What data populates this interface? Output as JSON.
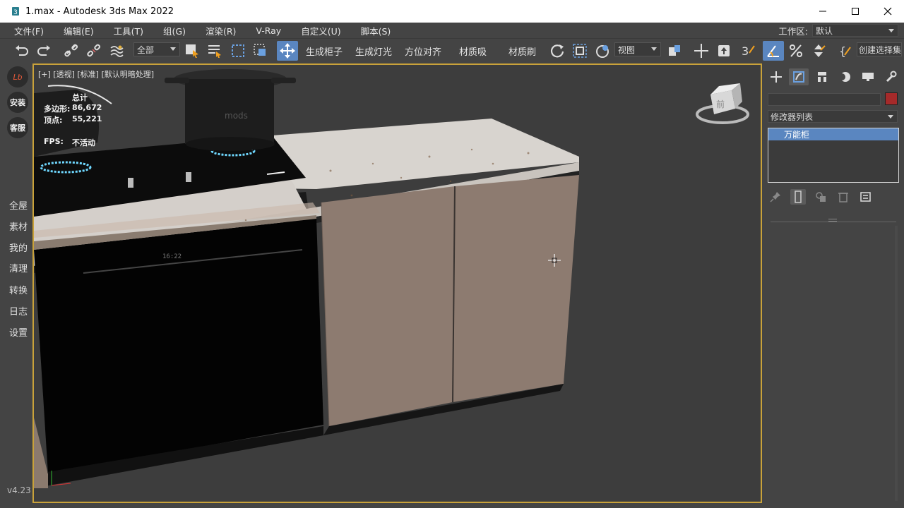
{
  "window": {
    "title": "1.max - Autodesk 3ds Max 2022"
  },
  "menu": [
    "文件(F)",
    "编辑(E)",
    "工具(T)",
    "组(G)",
    "渲染(R)",
    "V-Ray",
    "自定义(U)",
    "脚本(S)"
  ],
  "workspace": {
    "label": "工作区:",
    "value": "默认"
  },
  "toolbar": {
    "selection_filter": "全部",
    "buttons": [
      "生成柜子",
      "生成灯光",
      "方位对齐",
      "材质吸",
      "材质刷"
    ],
    "ref_coord": "视图",
    "named_selection": "创建选择集"
  },
  "sidebar": {
    "round_buttons": [
      "Lb",
      "安装",
      "客服"
    ],
    "links": [
      "全屋",
      "素材",
      "我的",
      "清理",
      "转换",
      "日志",
      "设置"
    ],
    "version": "v4.23"
  },
  "viewport": {
    "label": "[+] [透视] [标准] [默认明暗处理]",
    "stats": {
      "header": "总计",
      "polygons_label": "多边形:",
      "polygons_value": "86,672",
      "vertices_label": "顶点:",
      "vertices_value": "55,221",
      "fps_label": "FPS:",
      "fps_value": "不活动"
    },
    "dishwasher_clock": "16:22",
    "pot_brand": "mods",
    "viewcube_label": "前"
  },
  "command_panel": {
    "modifier_list": "修改器列表",
    "stack_item": "万能柜"
  },
  "colors": {
    "viewport_border": "#c9a23a",
    "selection_blue": "#5a86c0",
    "object_color": "#a52a2a"
  }
}
